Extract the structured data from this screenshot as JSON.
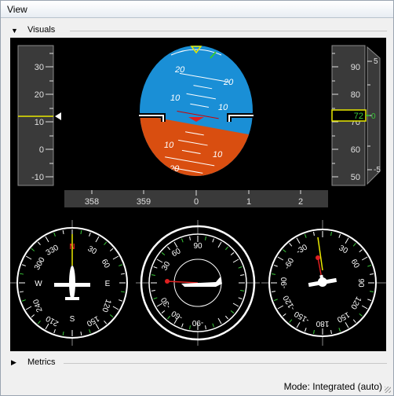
{
  "window": {
    "title": "View"
  },
  "visuals": {
    "label": "Visuals",
    "left_tape": {
      "ticks": [
        "30",
        "20",
        "10",
        "0",
        "-10"
      ],
      "value": 12
    },
    "right_tape": {
      "ticks": [
        "90",
        "80",
        "70",
        "60",
        "50"
      ],
      "value": "72",
      "pointer_value": "0"
    },
    "vsi": {
      "ticks": [
        "5",
        "0",
        "-5"
      ]
    },
    "horizon": {
      "pitch_labels": [
        "20",
        "10",
        "10",
        "20"
      ]
    },
    "heading_tape": {
      "ticks": [
        "358",
        "359",
        "0",
        "1",
        "2"
      ]
    },
    "compass1": {
      "labels": [
        "330",
        "N",
        "30",
        "60",
        "E",
        "120",
        "150",
        "S",
        "210",
        "240",
        "W",
        "300"
      ],
      "cardinals": [
        "N",
        "E",
        "S",
        "W"
      ]
    },
    "compass2": {
      "labels": [
        "90",
        "60",
        "30",
        "-30",
        "-60",
        "-90",
        "30",
        "60"
      ]
    },
    "compass3": {
      "labels": [
        "30",
        "60",
        "90",
        "120",
        "150",
        "180",
        "-150",
        "-120",
        "-90",
        "-60",
        "-30",
        "0"
      ]
    }
  },
  "metrics": {
    "label": "Metrics"
  },
  "status": {
    "mode_text": "Mode: Integrated (auto)"
  },
  "colors": {
    "sky": "#1a8fd6",
    "ground": "#d94e10",
    "tape_bg": "#3a3a3a",
    "accent_green": "#38c838",
    "marker_yellow": "#e8e800",
    "needle_red": "#e02020"
  }
}
